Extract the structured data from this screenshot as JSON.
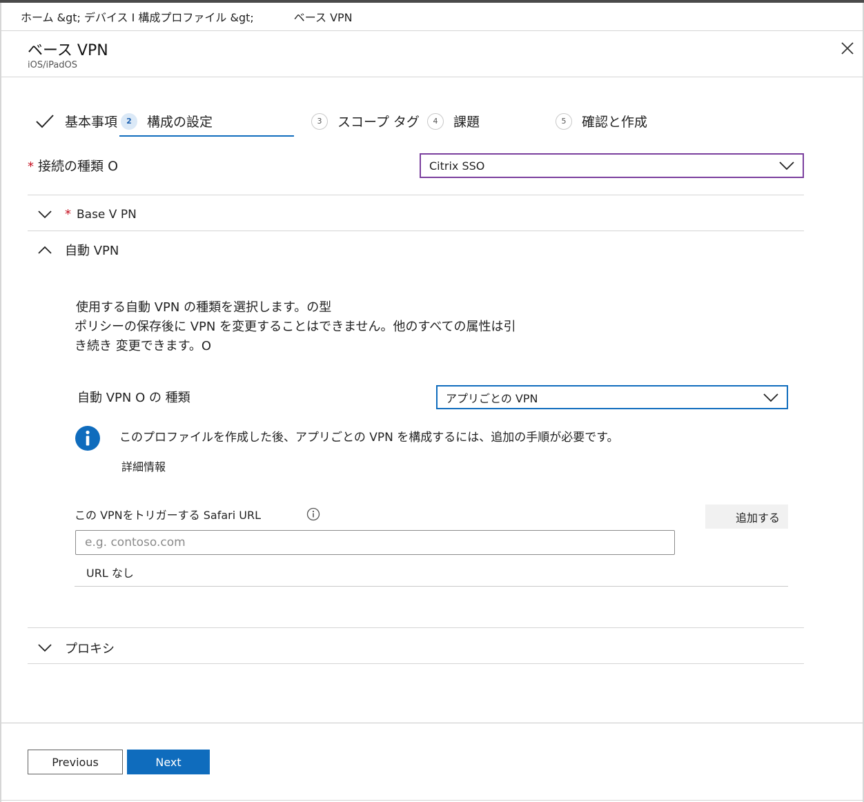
{
  "breadcrumb": {
    "parent": "ホーム &gt; デバイス I 構成プロファイル &gt;",
    "current": "ベース VPN"
  },
  "header": {
    "title": "ベース VPN",
    "subtitle": "iOS/iPadOS"
  },
  "wizard": {
    "steps": [
      {
        "label": "基本事項",
        "state": "completed"
      },
      {
        "number": "2",
        "label": "構成の設定",
        "state": "active"
      },
      {
        "number": "3",
        "label": "スコープ タグ",
        "state": "pending"
      },
      {
        "number": "4",
        "label": "課題",
        "state": "pending"
      },
      {
        "number": "5",
        "label": "確認と作成",
        "state": "pending"
      }
    ]
  },
  "connection": {
    "required_mark": "*",
    "label": "接続の種類 O",
    "value": "Citrix SSO"
  },
  "sections": {
    "base_vpn": {
      "required_mark": "*",
      "label": "Base V PN",
      "expanded": false
    },
    "auto_vpn": {
      "label": "自動 VPN",
      "expanded": true
    },
    "proxy": {
      "label": "プロキシ",
      "expanded": false
    }
  },
  "auto_vpn": {
    "description": [
      "使用する自動 VPN の種類を選択します。の型",
      "ポリシーの保存後に VPN を変更することはできません。他のすべての属性は引",
      "き続き 変更できます。O"
    ],
    "type_label": "自動 VPN O の 種類",
    "type_value": "アプリごとの VPN",
    "info_text": "このプロファイルを作成した後、アプリごとの VPN を構成するには、追加の手順が必要です。",
    "more_info": "詳細情報",
    "safari_url_label": "この VPNをトリガーする Safari URL",
    "add_button": "追加する",
    "url_placeholder": "e.g. contoso.com",
    "url_value": "",
    "no_url": "URL なし"
  },
  "footer": {
    "previous": "Previous",
    "next": "Next"
  },
  "colors": {
    "accent": "#0f6cbd",
    "required": "#c50f1f",
    "select_focus_purple": "#7a3e9d"
  }
}
